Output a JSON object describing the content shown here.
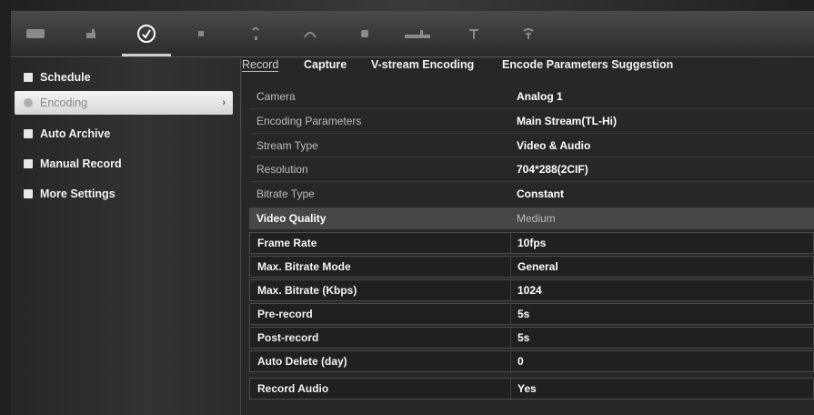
{
  "toolbar": {
    "icons": [
      {
        "name": "monitor-icon"
      },
      {
        "name": "camera-icon"
      },
      {
        "name": "record-settings-icon",
        "active": true
      },
      {
        "name": "alarm-icon"
      },
      {
        "name": "network-icon"
      },
      {
        "name": "user-icon"
      },
      {
        "name": "device-icon"
      },
      {
        "name": "hdd-icon"
      },
      {
        "name": "system-icon"
      },
      {
        "name": "maintenance-icon"
      }
    ]
  },
  "sidebar": {
    "items": [
      {
        "label": "Schedule",
        "icon": "schedule-icon"
      },
      {
        "label": "Encoding",
        "icon": "encoding-icon",
        "active": true
      },
      {
        "label": "Auto Archive",
        "icon": "archive-icon"
      },
      {
        "label": "Manual Record",
        "icon": "manual-record-icon"
      },
      {
        "label": "More Settings",
        "icon": "more-settings-icon"
      }
    ]
  },
  "tabs": [
    {
      "label": "Record",
      "active": true
    },
    {
      "label": "Capture"
    },
    {
      "label": "V-stream Encoding"
    },
    {
      "label": "Encode Parameters Suggestion"
    }
  ],
  "settings": [
    {
      "label": "Camera",
      "value": "Analog 1"
    },
    {
      "label": "Encoding Parameters",
      "value": "Main Stream(TL-Hi)"
    },
    {
      "label": "Stream Type",
      "value": "Video & Audio"
    },
    {
      "label": "Resolution",
      "value": "704*288(2CIF)"
    },
    {
      "label": "Bitrate Type",
      "value": "Constant"
    },
    {
      "label": "Video Quality",
      "value": "Medium"
    },
    {
      "label": "Frame Rate",
      "value": "10fps"
    },
    {
      "label": "Max. Bitrate Mode",
      "value": "General"
    },
    {
      "label": "Max. Bitrate (Kbps)",
      "value": "1024"
    },
    {
      "label": "Pre-record",
      "value": "5s"
    },
    {
      "label": "Post-record",
      "value": "5s"
    },
    {
      "label": "Auto Delete (day)",
      "value": "0"
    },
    {
      "label": "Record Audio",
      "value": "Yes"
    }
  ]
}
